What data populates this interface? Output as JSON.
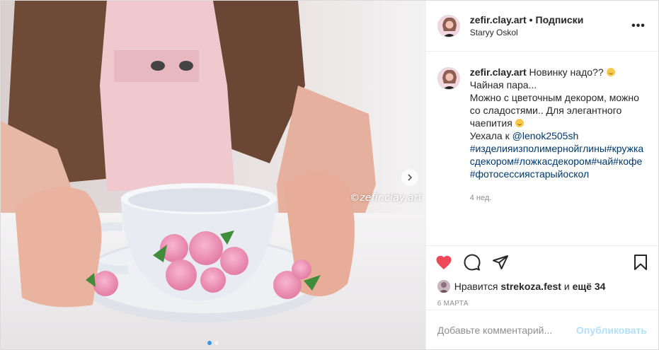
{
  "photo": {
    "watermark": "©zefir.clay.art",
    "next_icon": "chevron-right-icon",
    "carousel_count": 2,
    "carousel_active": 1
  },
  "header": {
    "username": "zefir.clay.art",
    "separator": "•",
    "follow_label": "Подписки",
    "location": "Staryy Oskol",
    "more_icon": "more-horizontal-icon",
    "more_label": "•••"
  },
  "caption": {
    "username": "zefir.clay.art",
    "line1": "Новинку надо??",
    "line2": "Чайная пара...",
    "line3": "Можно с цветочным декором, можно со сладостями.. Для элегантного чаепития",
    "line4_prefix": "Уехала к",
    "mention": "@lenok2505sh",
    "hashtags": "#изделияизполимернойглины#кружкасдекором#ложкасдекором#чай#кофе#фотосессиястарыйоскол",
    "time": "4 нед."
  },
  "actions": {
    "like_icon": "heart-filled-icon",
    "comment_icon": "comment-icon",
    "share_icon": "share-icon",
    "save_icon": "bookmark-icon",
    "like_color": "#ed4956"
  },
  "likes": {
    "prefix": "Нравится",
    "user": "strekoza.fest",
    "and": "и",
    "others": "ещё 34"
  },
  "date": "6 МАРТА",
  "comment": {
    "placeholder": "Добавьте комментарий...",
    "publish_label": "Опубликовать"
  },
  "colors": {
    "link": "#00376b",
    "publish_disabled": "#b2dffc",
    "muted": "#8e8e8e"
  }
}
